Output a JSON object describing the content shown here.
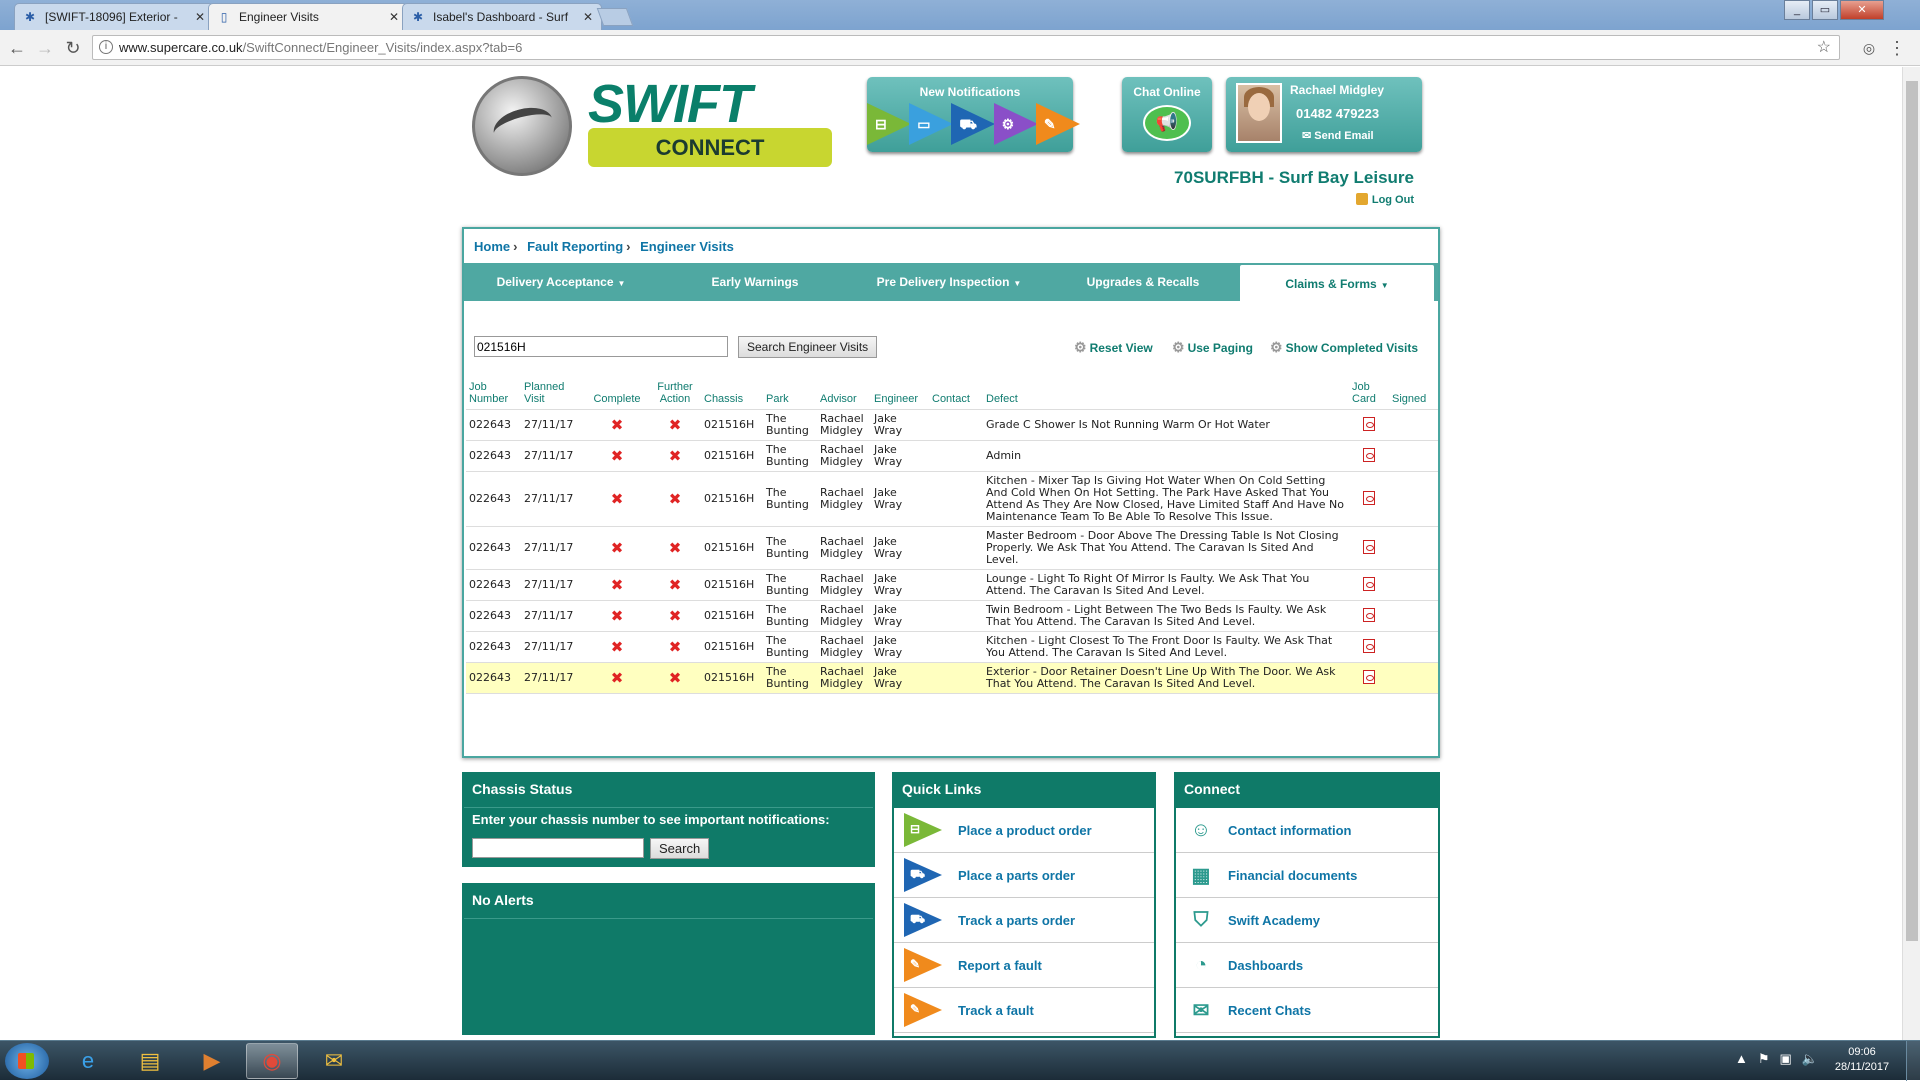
{
  "browser": {
    "tabs": [
      {
        "title": "[SWIFT-18096] Exterior -",
        "icon": "jira-icon",
        "active": false
      },
      {
        "title": "Engineer Visits",
        "icon": "page-icon",
        "active": true
      },
      {
        "title": "Isabel's Dashboard - Surf",
        "icon": "jira-icon",
        "active": false
      }
    ],
    "url_host": "www.supercare.co.uk",
    "url_path": "/SwiftConnect/Engineer_Visits/index.aspx?tab=6"
  },
  "header": {
    "logo_top": "SWIFT",
    "logo_bottom": "CONNECT",
    "notifications_title": "New Notifications",
    "notification_icons": [
      {
        "name": "caravan-icon",
        "color": "#7ab838",
        "glyph": "⊟"
      },
      {
        "name": "monitor-icon",
        "color": "#3aa0de",
        "glyph": "▭"
      },
      {
        "name": "truck-icon",
        "color": "#1f66b3",
        "glyph": "⛟"
      },
      {
        "name": "gear-icon",
        "color": "#8a4fc8",
        "glyph": "⚙"
      },
      {
        "name": "tools-icon",
        "color": "#f08a1c",
        "glyph": "✎"
      }
    ],
    "chat_title": "Chat Online",
    "advisor_name": "Rachael Midgley",
    "advisor_phone": "01482 479223",
    "send_email": "Send Email",
    "dealer": "70SURFBH - Surf Bay Leisure",
    "logout": "Log Out"
  },
  "breadcrumb": [
    "Home",
    "Fault Reporting",
    "Engineer Visits"
  ],
  "tabs": [
    {
      "label": "Delivery Acceptance",
      "dropdown": true,
      "active": false
    },
    {
      "label": "Early Warnings",
      "dropdown": false,
      "active": false
    },
    {
      "label": "Pre Delivery Inspection",
      "dropdown": true,
      "active": false
    },
    {
      "label": "Upgrades & Recalls",
      "dropdown": false,
      "active": false
    },
    {
      "label": "Claims & Forms",
      "dropdown": true,
      "active": true
    }
  ],
  "search": {
    "value": "021516H",
    "button": "Search Engineer Visits"
  },
  "options": {
    "reset": "Reset View",
    "paging": "Use Paging",
    "completed": "Show Completed Visits"
  },
  "table": {
    "headers": [
      "Job Number",
      "Planned Visit",
      "Complete",
      "Further Action",
      "Chassis",
      "Park",
      "Advisor",
      "Engineer",
      "Contact",
      "Defect",
      "Job Card",
      "Signed"
    ],
    "rows": [
      {
        "job": "022643",
        "visit": "27/11/17",
        "chassis": "021516H",
        "park": "The Bunting",
        "advisor": "Rachael Midgley",
        "engineer": "Jake Wray",
        "contact": "",
        "defect": "Grade C Shower Is Not Running Warm Or Hot Water",
        "highlight": false
      },
      {
        "job": "022643",
        "visit": "27/11/17",
        "chassis": "021516H",
        "park": "The Bunting",
        "advisor": "Rachael Midgley",
        "engineer": "Jake Wray",
        "contact": "",
        "defect": "Admin",
        "highlight": false
      },
      {
        "job": "022643",
        "visit": "27/11/17",
        "chassis": "021516H",
        "park": "The Bunting",
        "advisor": "Rachael Midgley",
        "engineer": "Jake Wray",
        "contact": "",
        "defect": "Kitchen - Mixer Tap Is Giving Hot Water When On Cold Setting And Cold When On Hot Setting. The Park Have Asked That You Attend As They Are Now Closed, Have Limited Staff And Have No Maintenance Team To Be Able To Resolve This Issue.",
        "highlight": false
      },
      {
        "job": "022643",
        "visit": "27/11/17",
        "chassis": "021516H",
        "park": "The Bunting",
        "advisor": "Rachael Midgley",
        "engineer": "Jake Wray",
        "contact": "",
        "defect": "Master Bedroom - Door Above The Dressing Table Is Not Closing Properly. We Ask That You Attend. The Caravan Is Sited And Level.",
        "highlight": false
      },
      {
        "job": "022643",
        "visit": "27/11/17",
        "chassis": "021516H",
        "park": "The Bunting",
        "advisor": "Rachael Midgley",
        "engineer": "Jake Wray",
        "contact": "",
        "defect": "Lounge - Light To Right Of Mirror Is Faulty. We Ask That You Attend. The Caravan Is Sited And Level.",
        "highlight": false
      },
      {
        "job": "022643",
        "visit": "27/11/17",
        "chassis": "021516H",
        "park": "The Bunting",
        "advisor": "Rachael Midgley",
        "engineer": "Jake Wray",
        "contact": "",
        "defect": "Twin Bedroom - Light Between The Two Beds Is Faulty. We Ask That You Attend. The Caravan Is Sited And Level.",
        "highlight": false
      },
      {
        "job": "022643",
        "visit": "27/11/17",
        "chassis": "021516H",
        "park": "The Bunting",
        "advisor": "Rachael Midgley",
        "engineer": "Jake Wray",
        "contact": "",
        "defect": "Kitchen - Light Closest To The Front Door Is Faulty. We Ask That You Attend. The Caravan Is Sited And Level.",
        "highlight": false
      },
      {
        "job": "022643",
        "visit": "27/11/17",
        "chassis": "021516H",
        "park": "The Bunting",
        "advisor": "Rachael Midgley",
        "engineer": "Jake Wray",
        "contact": "",
        "defect": "Exterior - Door Retainer Doesn't Line Up With The Door. We Ask That You Attend. The Caravan Is Sited And Level.",
        "highlight": true
      }
    ]
  },
  "chassis_status": {
    "title": "Chassis Status",
    "label": "Enter your chassis number to see important notifications:",
    "button": "Search"
  },
  "alerts": {
    "title": "No Alerts"
  },
  "quick_links": {
    "title": "Quick Links",
    "items": [
      {
        "label": "Place a product order",
        "icon": "caravan-icon",
        "color": "#7ab838",
        "glyph": "⊟"
      },
      {
        "label": "Place a parts order",
        "icon": "truck-icon",
        "color": "#1f66b3",
        "glyph": "⛟"
      },
      {
        "label": "Track a parts order",
        "icon": "truck-icon",
        "color": "#1f66b3",
        "glyph": "⛟"
      },
      {
        "label": "Report a fault",
        "icon": "tools-icon",
        "color": "#f08a1c",
        "glyph": "✎"
      },
      {
        "label": "Track a fault",
        "icon": "tools-icon",
        "color": "#f08a1c",
        "glyph": "✎"
      }
    ]
  },
  "connect": {
    "title": "Connect",
    "items": [
      {
        "label": "Contact information",
        "icon": "people-icon",
        "glyph": "☺"
      },
      {
        "label": "Financial documents",
        "icon": "calculator-icon",
        "glyph": "▦"
      },
      {
        "label": "Swift Academy",
        "icon": "academy-icon",
        "glyph": "⛉"
      },
      {
        "label": "Dashboards",
        "icon": "dashboard-icon",
        "glyph": "◔"
      },
      {
        "label": "Recent Chats",
        "icon": "chat-icon",
        "glyph": "✉"
      }
    ]
  },
  "taskbar": {
    "time": "09:06",
    "date": "28/11/2017"
  }
}
